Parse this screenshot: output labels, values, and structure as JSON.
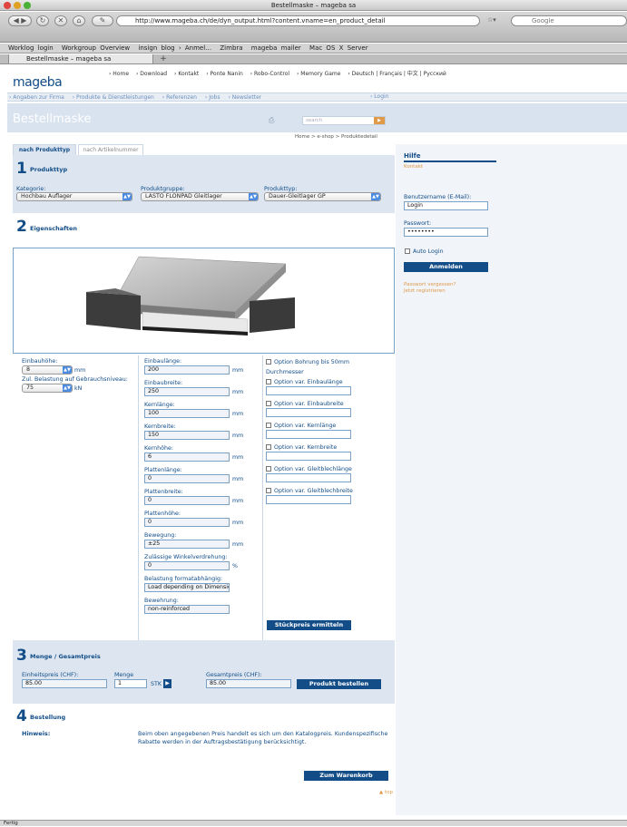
{
  "browser": {
    "window_title": "Bestellmaske – mageba sa",
    "url": "http://www.mageba.ch/de/dyn_output.html?content.vname=en_product_detail",
    "search_placeholder": "Google",
    "bookmarks": [
      "Worklog login",
      "Workgroup Overview",
      "insign blog › Anmel…",
      "Zimbra",
      "mageba mailer",
      "Mac OS X Server"
    ],
    "tab_title": "Bestellmaske – mageba sa",
    "status": "Fertig"
  },
  "site": {
    "logo": "mageba",
    "top_nav": [
      "› Home",
      "› Download",
      "› Kontakt",
      "› Ponte Nanin",
      "› Robo-Control",
      "› Memory Game",
      "› Deutsch | Français | 中文 | Русский"
    ],
    "menu": [
      "› Angaben zur Firma",
      "› Produkte & Dienstleistungen",
      "› Referenzen",
      "› Jobs",
      "› Newsletter"
    ],
    "login_link": "› Login",
    "page_title": "Bestellmaske",
    "search_placeholder": "search",
    "breadcrumb": "Home  >  e-shop  >  Produktedetail"
  },
  "tabs": [
    "nach Produkttyp",
    "nach Artikelnummer"
  ],
  "s1": {
    "num": "1",
    "title": "Produkttyp",
    "kategorie_label": "Kategorie:",
    "kategorie": "Hochbau Auflager",
    "gruppe_label": "Produktgruppe:",
    "gruppe": "LASTO FLONPAD Gleitlager",
    "typ_label": "Produkttyp:",
    "typ": "Dauer-Gleitlager GP"
  },
  "s2": {
    "num": "2",
    "title": "Eigenschaften",
    "einbauhoehe_label": "Einbauhöhe:",
    "einbauhoehe": "8",
    "unit_mm": "mm",
    "belastung_label": "Zul. Belastung auf Gebrauchsniveau:",
    "belastung": "75",
    "unit_kn": "kN",
    "fields": [
      {
        "label": "Einbaulänge:",
        "value": "200",
        "unit": "mm"
      },
      {
        "label": "Einbaubreite:",
        "value": "250",
        "unit": "mm"
      },
      {
        "label": "Kernlänge:",
        "value": "100",
        "unit": "mm"
      },
      {
        "label": "Kernbreite:",
        "value": "150",
        "unit": "mm"
      },
      {
        "label": "Kernhöhe:",
        "value": "6",
        "unit": "mm"
      },
      {
        "label": "Plattenlänge:",
        "value": "0",
        "unit": "mm"
      },
      {
        "label": "Plattenbreite:",
        "value": "0",
        "unit": "mm"
      },
      {
        "label": "Plattenhöhe:",
        "value": "0",
        "unit": "mm"
      },
      {
        "label": "Bewegung:",
        "value": "±25",
        "unit": "mm"
      },
      {
        "label": "Zulässige Winkelverdrehung:",
        "value": "0",
        "unit": "%"
      },
      {
        "label": "Belastung formatabhängig:",
        "value": "Load depending on Dimension",
        "unit": ""
      },
      {
        "label": "Bewehrung:",
        "value": "non-reinforced",
        "unit": ""
      }
    ],
    "option_bohrung": "Option Bohrung bis 50mm",
    "option_bohrung_2": "Durchmesser",
    "options": [
      "Option var. Einbaulänge",
      "Option var. Einbaubreite",
      "Option var. Kernlänge",
      "Option var. Kernbreite",
      "Option var. Gleitblechlänge",
      "Option var. Gleitblechbreite"
    ],
    "stueckpreis_btn": "Stückpreis ermitteln"
  },
  "s3": {
    "num": "3",
    "title": "Menge / Gesamtpreis",
    "einheit_label": "Einheitspreis (CHF):",
    "einheit": "85.00",
    "menge_label": "Menge",
    "menge": "1",
    "stk": "STK",
    "gesamt_label": "Gesamtpreis (CHF):",
    "gesamt": "85.00",
    "bestellen_btn": "Produkt bestellen"
  },
  "s4": {
    "num": "4",
    "title": "Bestellung",
    "hinweis_label": "Hinweis:",
    "hinweis": "Beim oben angegebenen Preis handelt es sich um den Katalogpreis. Kundenspezifische Rabatte werden in der Auftragsbestätigung berücksichtigt.",
    "warenkorb_btn": "Zum Warenkorb",
    "top_link": "▲ top"
  },
  "sidebar": {
    "title": "Hilfe",
    "kontakt": "Kontakt",
    "user_label": "Benutzername (E-Mail):",
    "user": "Login",
    "pass_label": "Passwort:",
    "pass": "••••••••",
    "auto_login": "Auto Login",
    "login_btn": "Anmelden",
    "forgot": "Passwort vergessen?",
    "register": "Jetzt registrieren"
  },
  "colors": {
    "brand": "#124d88",
    "section_bg": "#dde6f0",
    "link_orange": "#e09a4a"
  }
}
